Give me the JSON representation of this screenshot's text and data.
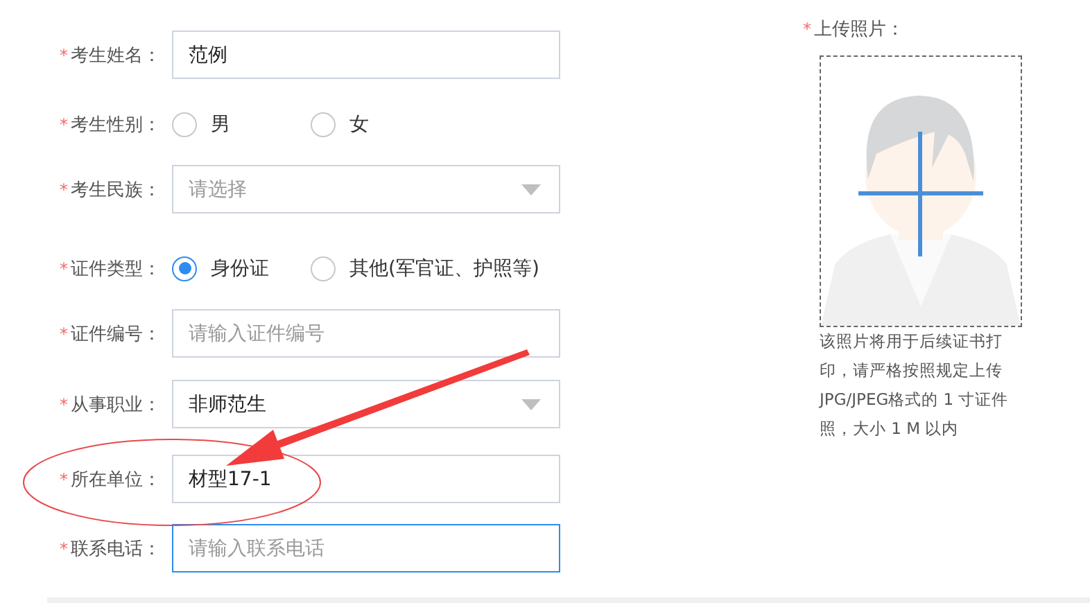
{
  "form": {
    "fields": [
      {
        "kind": "text",
        "mark": "*",
        "label": "考生姓名：",
        "value": "范例",
        "focused": false
      },
      {
        "kind": "radio",
        "mark": "*",
        "label": "考生性别：",
        "options": [
          {
            "label": "男",
            "selected": false
          },
          {
            "label": "女",
            "selected": false
          }
        ]
      },
      {
        "kind": "select",
        "mark": "*",
        "label": "考生民族：",
        "placeholder": "请选择"
      },
      {
        "kind": "radio",
        "mark": "*",
        "label": "证件类型：",
        "options": [
          {
            "label": "身份证",
            "selected": true
          },
          {
            "label": "其他(军官证、护照等)",
            "selected": false
          }
        ]
      },
      {
        "kind": "text",
        "mark": "*",
        "label": "证件编号：",
        "placeholder": "请输入证件编号",
        "focused": false
      },
      {
        "kind": "select",
        "mark": "*",
        "label": "从事职业：",
        "value": "非师范生"
      },
      {
        "kind": "text",
        "mark": "*",
        "label": "所在单位：",
        "value": "材型17-1",
        "focused": false
      },
      {
        "kind": "text",
        "mark": "*",
        "label": "联系电话：",
        "placeholder": "请输入联系电话",
        "focused": true
      }
    ]
  },
  "photo": {
    "mark": "*",
    "label": "上传照片：",
    "hint": "该照片将用于后续证书打印，请严格按照规定上传JPG/JPEG格式的 1 寸证件照，大小 1 M 以内"
  }
}
